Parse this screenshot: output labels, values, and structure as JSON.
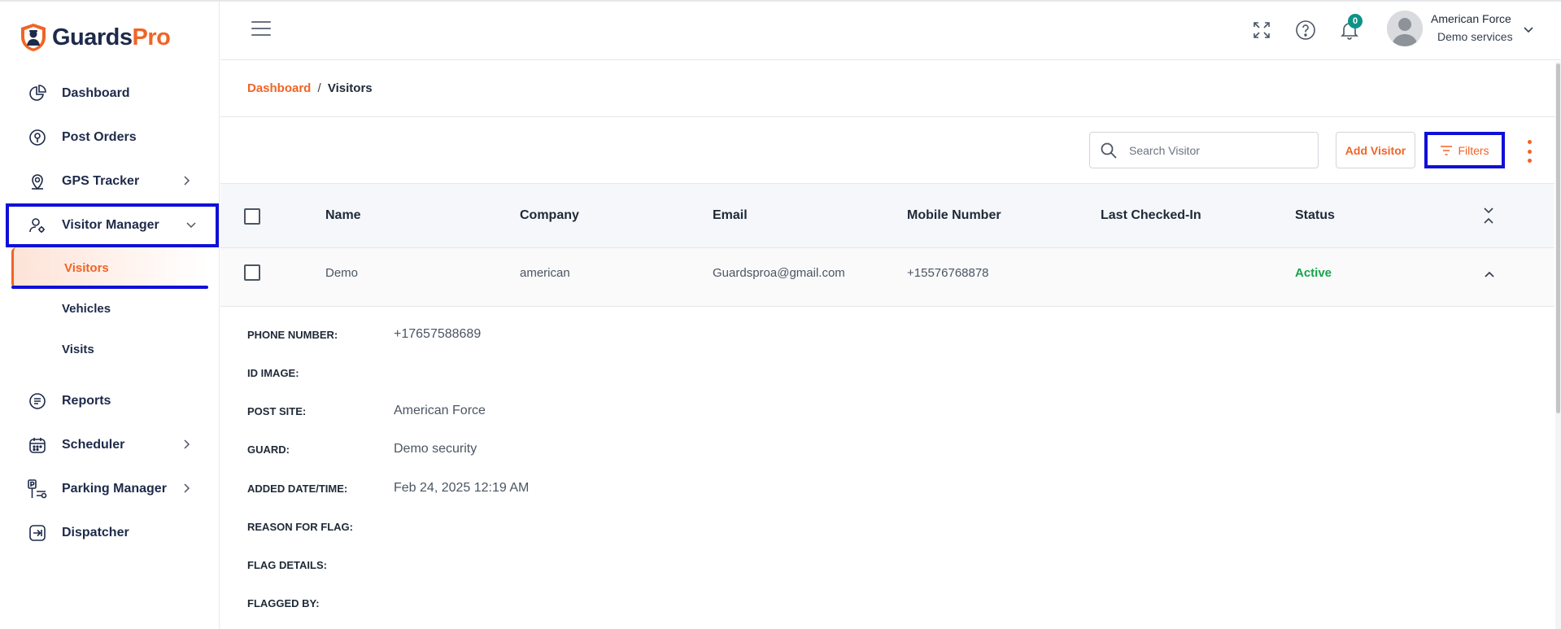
{
  "brand": {
    "name_part1": "Guards",
    "name_part2": "Pro",
    "accent_color": "#f06426",
    "navy_color": "#1e2a4a"
  },
  "sidebar": {
    "items": [
      {
        "label": "Dashboard",
        "icon": "pie-chart-icon"
      },
      {
        "label": "Post Orders",
        "icon": "location-badge-icon"
      },
      {
        "label": "GPS Tracker",
        "icon": "map-pin-icon",
        "has_children": true
      },
      {
        "label": "Visitor Manager",
        "icon": "user-gear-icon",
        "expanded": true
      },
      {
        "label": "Reports",
        "icon": "document-list-icon"
      },
      {
        "label": "Scheduler",
        "icon": "calendar-icon",
        "has_children": true
      },
      {
        "label": "Parking Manager",
        "icon": "parking-icon",
        "has_children": true
      },
      {
        "label": "Dispatcher",
        "icon": "login-arrow-icon"
      }
    ],
    "subitems": [
      {
        "label": "Visitors",
        "active": true
      },
      {
        "label": "Vehicles"
      },
      {
        "label": "Visits"
      }
    ]
  },
  "topbar": {
    "notification_count": "0",
    "user_name": "American Force",
    "user_org": "Demo services"
  },
  "breadcrumb": {
    "root": "Dashboard",
    "separator": "/",
    "current": "Visitors"
  },
  "toolbar": {
    "search_placeholder": "Search Visitor",
    "add_label": "Add Visitor",
    "filter_label": "Filters"
  },
  "table": {
    "columns": [
      "Name",
      "Company",
      "Email",
      "Mobile Number",
      "Last Checked-In",
      "Status"
    ],
    "rows": [
      {
        "name": "Demo",
        "company": "american",
        "email": "Guardsproa@gmail.com",
        "mobile": "+15576768878",
        "last_checked_in": "",
        "status": "Active"
      }
    ]
  },
  "detail": [
    {
      "label": "PHONE NUMBER:",
      "value": "+17657588689"
    },
    {
      "label": "ID IMAGE:",
      "value": ""
    },
    {
      "label": "POST SITE:",
      "value": "American Force"
    },
    {
      "label": "GUARD:",
      "value": "Demo security"
    },
    {
      "label": "ADDED DATE/TIME:",
      "value": "Feb 24, 2025 12:19 AM"
    },
    {
      "label": "REASON FOR FLAG:",
      "value": ""
    },
    {
      "label": "FLAG DETAILS:",
      "value": ""
    },
    {
      "label": "FLAGGED BY:",
      "value": ""
    }
  ],
  "status_color": "#16a34a",
  "highlight_color": "#1010d8"
}
